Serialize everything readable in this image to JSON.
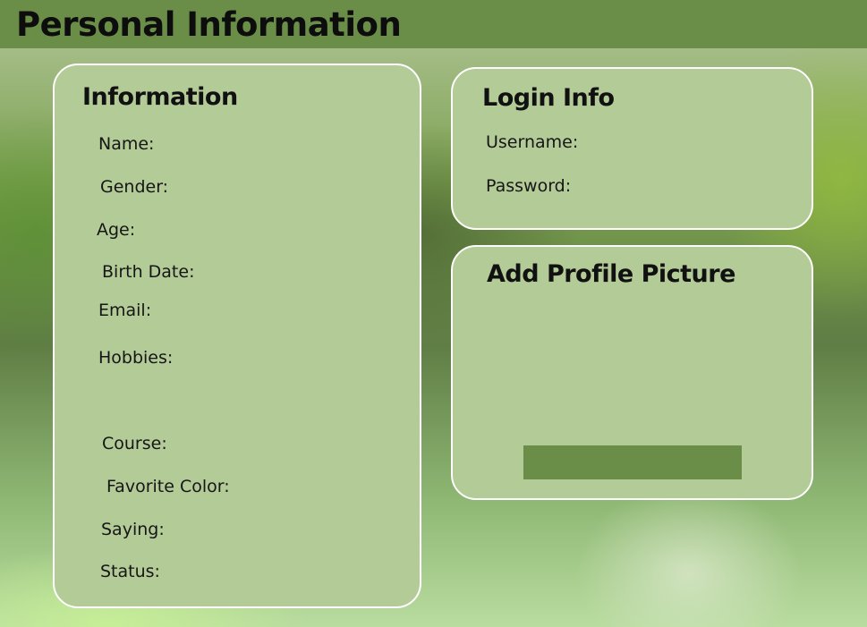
{
  "header": {
    "title": "Personal Information"
  },
  "information": {
    "title": "Information",
    "fields": [
      "Name:",
      "Gender:",
      "Age:",
      "Birth Date:",
      "Email:",
      "Hobbies:",
      "Course:",
      "Favorite Color:",
      "Saying:",
      "Status:"
    ]
  },
  "login": {
    "title": "Login Info",
    "fields": [
      "Username:",
      "Password:"
    ]
  },
  "profile_picture": {
    "title": "Add Profile Picture"
  },
  "colors": {
    "header_bg": "#6a8e47",
    "panel_bg": "#b3cb97",
    "panel_border": "#ffffff",
    "button_bg": "#6a8e47"
  }
}
